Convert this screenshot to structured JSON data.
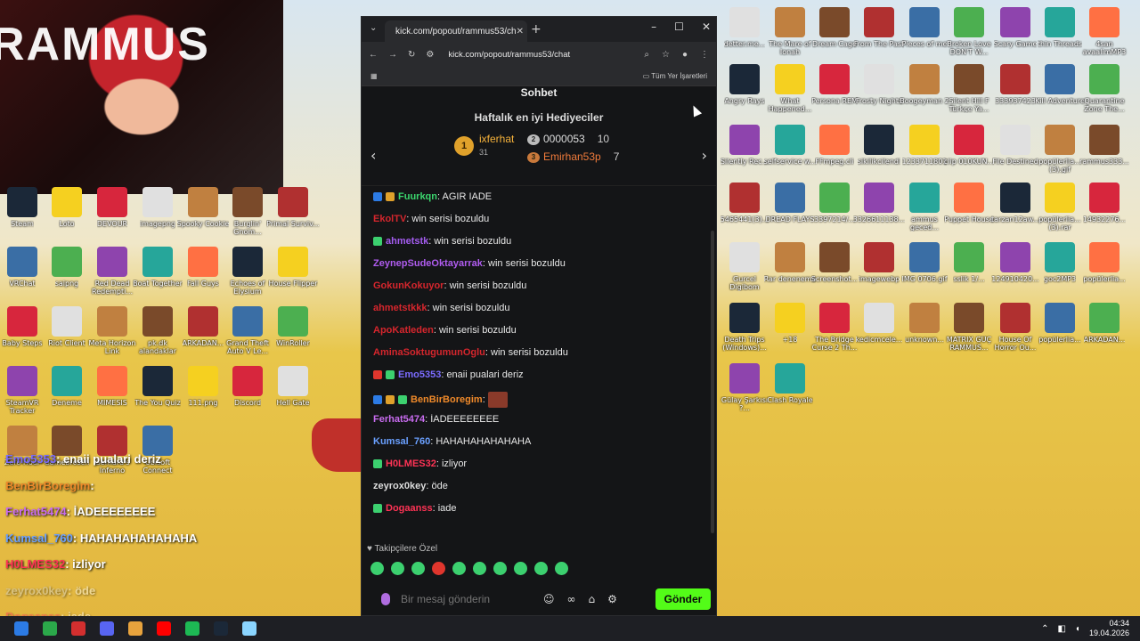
{
  "webcam": {
    "brand_text": "RAMMUS"
  },
  "desktop_icons_left": [
    {
      "label": "Steam"
    },
    {
      "label": "Loto"
    },
    {
      "label": "DEVOUR"
    },
    {
      "label": "imagepng"
    },
    {
      "label": "Spooky Cookie"
    },
    {
      "label": "Burglin' Gnom..."
    },
    {
      "label": "Primal Surviv..."
    },
    {
      "label": "VRChat"
    },
    {
      "label": "saipng"
    },
    {
      "label": "Red Dead Redempti..."
    },
    {
      "label": "Boat Together"
    },
    {
      "label": "Fall Guys"
    },
    {
      "label": "Echoes of Elysium"
    },
    {
      "label": "House Flipper"
    },
    {
      "label": "Baby Steps"
    },
    {
      "label": "Riot Client"
    },
    {
      "label": "Meta Horizon Link"
    },
    {
      "label": "pk.dk alandaklar"
    },
    {
      "label": "ARKADAN..."
    },
    {
      "label": "Grand Theft Auto V Le..."
    },
    {
      "label": "WinRoller"
    },
    {
      "label": "SteamVR Tracker"
    },
    {
      "label": "Deneme"
    },
    {
      "label": "MIMESIS"
    },
    {
      "label": "The You Quiz"
    },
    {
      "label": "111.png"
    },
    {
      "label": "Discord"
    },
    {
      "label": "Hell Gate"
    },
    {
      "label": "Zero Hour"
    },
    {
      "label": "Gamebrosch"
    },
    {
      "label": "Gerhard's Inferno"
    },
    {
      "label": "Ubisoft Connect"
    }
  ],
  "desktop_icons_right": [
    {
      "label": "detter.me..."
    },
    {
      "label": "The Mare of Ionah"
    },
    {
      "label": "Dream Cage"
    },
    {
      "label": "From The Past"
    },
    {
      "label": "Pieces of me"
    },
    {
      "label": "Broken Love DON'T W..."
    },
    {
      "label": "Scary Game"
    },
    {
      "label": "thin Threads"
    },
    {
      "label": "4san avaalimMP3"
    },
    {
      "label": "Angry Rays"
    },
    {
      "label": "What Happened..."
    },
    {
      "label": "Persona REM"
    },
    {
      "label": "Frosty Nights"
    },
    {
      "label": "Boogeyman 2"
    },
    {
      "label": "Silent Hill F Türkçe Ya..."
    },
    {
      "label": "333937423"
    },
    {
      "label": "Kill Adventure"
    },
    {
      "label": "Quarantine Zone The..."
    },
    {
      "label": "Silently Rec..."
    },
    {
      "label": "selfservice w..."
    },
    {
      "label": "FFmpeg.cli"
    },
    {
      "label": "sikilikcilendi"
    },
    {
      "label": "1233711801"
    },
    {
      "label": "clip 010KUN..."
    },
    {
      "label": "File Destined"
    },
    {
      "label": "popülerlia... (3).gif"
    },
    {
      "label": "rammus333..."
    },
    {
      "label": "5465441(3)..."
    },
    {
      "label": "DREAD FLAYS"
    },
    {
      "label": "3397214/..."
    },
    {
      "label": "3326611138..."
    },
    {
      "label": "ammus geced..."
    },
    {
      "label": "Puppet House"
    },
    {
      "label": "tarzan12aw..."
    },
    {
      "label": "popülerlia... (3).rar"
    },
    {
      "label": "14932276..."
    },
    {
      "label": "Gurcel Digibom"
    },
    {
      "label": "Rar deneneme"
    },
    {
      "label": "Screenshot..."
    },
    {
      "label": "imagewebp"
    },
    {
      "label": "IMG 0706.gif"
    },
    {
      "label": "sslik 1/..."
    },
    {
      "label": "124910420..."
    },
    {
      "label": "goc2MP3"
    },
    {
      "label": "popülerlia..."
    },
    {
      "label": "Death Trips (Windows)..."
    },
    {
      "label": "+18"
    },
    {
      "label": "The Bridge Curse 2 Th..."
    },
    {
      "label": "kedicmcele..."
    },
    {
      "label": "unknown..."
    },
    {
      "label": "MATRIX GÜÇ RAMMUS..."
    },
    {
      "label": "House Of Horror Ou..."
    },
    {
      "label": "popülerlia..."
    },
    {
      "label": "ARKADAN..."
    },
    {
      "label": "Gülay Şarkısı ?..."
    },
    {
      "label": "Clash Royale"
    }
  ],
  "overlay_chat": [
    {
      "user": "Emo5353",
      "text": "enaii pualari deriz",
      "color": "#7b6cff"
    },
    {
      "user": "BenBirBoregim",
      "text": "",
      "color": "#f08a2a"
    },
    {
      "user": "Ferhat5474",
      "text": "İADEEEEEEEE",
      "color": "#c96cf0"
    },
    {
      "user": "Kumsal_760",
      "text": "HAHAHAHAHAHAHA",
      "color": "#6aa0ff"
    },
    {
      "user": "H0LMES32",
      "text": "izliyor",
      "color": "#ff3355"
    },
    {
      "user": "zeyrox0key",
      "text": "öde",
      "color": "#cccccc"
    },
    {
      "user": "Dogaanss",
      "text": "iade",
      "color": "#ff3355"
    }
  ],
  "browser": {
    "tab_title": "kick.com/popout/rammus53/ch",
    "url": "kick.com/popout/rammus53/chat",
    "bookmarks_label": "Tüm Yer İşaretleri"
  },
  "chat": {
    "header": "Sohbet",
    "gifters_title": "Haftalık en iyi Hediyeciler",
    "gifters": {
      "first": {
        "rank": "1",
        "name": "ixferhat",
        "count": "31"
      },
      "second": {
        "rank": "2",
        "name": "0000053",
        "count": "10"
      },
      "third": {
        "rank": "3",
        "name": "Emirhan53p",
        "count": "7"
      }
    },
    "messages": [
      {
        "user": "Fuurkqn",
        "text": "AGIR IADE",
        "color": "#3bd66e"
      },
      {
        "user": "EkolTV",
        "text": "win serisi bozuldu",
        "color": "#d6262d"
      },
      {
        "user": "ahmetstk",
        "text": "win serisi bozuldu",
        "color": "#a45cf0"
      },
      {
        "user": "ZeynepSudeOktayarrak",
        "text": "win serisi bozuldu",
        "color": "#b05cf0"
      },
      {
        "user": "GokunKokuyor",
        "text": "win serisi bozuldu",
        "color": "#d6262d"
      },
      {
        "user": "ahmetstkkk",
        "text": "win serisi bozuldu",
        "color": "#d6262d"
      },
      {
        "user": "ApoKatleden",
        "text": "win serisi bozuldu",
        "color": "#d6262d"
      },
      {
        "user": "AminaSoktugumunOglu",
        "text": "win serisi bozuldu",
        "color": "#d6262d"
      },
      {
        "user": "Emo5353",
        "text": "enaii pualari deriz",
        "color": "#7b6cff"
      },
      {
        "user": "BenBirBoregim",
        "text": "",
        "color": "#f08a2a"
      },
      {
        "user": "Ferhat5474",
        "text": "İADEEEEEEEE",
        "color": "#c96cf0"
      },
      {
        "user": "Kumsal_760",
        "text": "HAHAHAHAHAHAHA",
        "color": "#6aa0ff"
      },
      {
        "user": "H0LMES32",
        "text": "izliyor",
        "color": "#ff3355"
      },
      {
        "user": "zeyrox0key",
        "text": "öde",
        "color": "#dddddd"
      },
      {
        "user": "Dogaanss",
        "text": "iade",
        "color": "#ff3355"
      }
    ],
    "followers_only": "Takipçilere Özel",
    "input_placeholder": "Bir mesaj gönderin",
    "send_label": "Gönder"
  },
  "clock": {
    "time": "04:34",
    "date": "19.04.2026"
  },
  "colors": {
    "kick_green": "#53fc18",
    "gold": "#f7b33b"
  }
}
